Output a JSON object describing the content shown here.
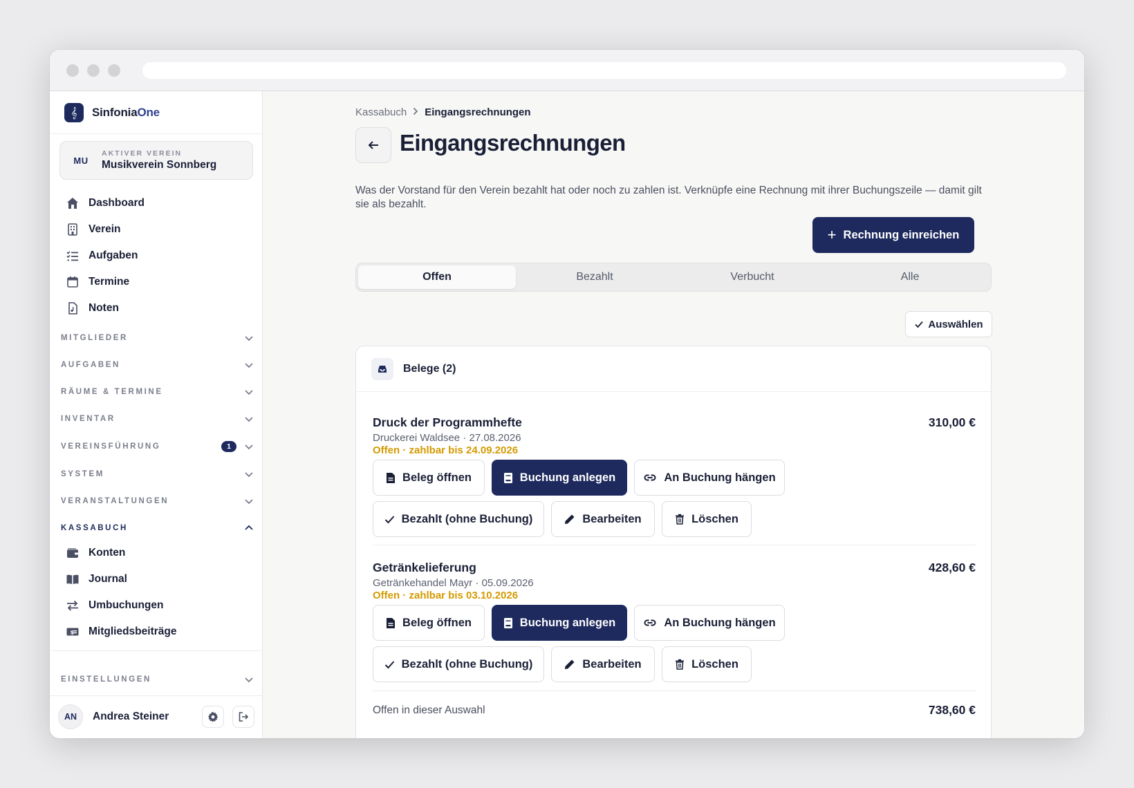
{
  "brand": {
    "name_a": "Sinfonia",
    "name_b": "One",
    "logo_icon": "treble-clef-icon"
  },
  "verein": {
    "code": "MU",
    "label": "AKTIVER VEREIN",
    "name": "Musikverein Sonnberg"
  },
  "nav_main": [
    {
      "label": "Dashboard",
      "icon": "home-icon"
    },
    {
      "label": "Verein",
      "icon": "building-icon"
    },
    {
      "label": "Aufgaben",
      "icon": "checklist-icon"
    },
    {
      "label": "Termine",
      "icon": "calendar-icon"
    },
    {
      "label": "Noten",
      "icon": "sheet-icon"
    }
  ],
  "sections": [
    {
      "label": "MITGLIEDER"
    },
    {
      "label": "AUFGABEN"
    },
    {
      "label": "RÄUME & TERMINE"
    },
    {
      "label": "INVENTAR"
    },
    {
      "label": "VEREINSFÜHRUNG",
      "badge": "1"
    },
    {
      "label": "SYSTEM"
    },
    {
      "label": "VERANSTALTUNGEN"
    },
    {
      "label": "KASSABUCH",
      "expanded": true
    }
  ],
  "kassabuch_items": [
    {
      "label": "Konten",
      "icon": "wallet-icon"
    },
    {
      "label": "Journal",
      "icon": "book-icon"
    },
    {
      "label": "Umbuchungen",
      "icon": "transfer-icon"
    },
    {
      "label": "Mitgliedsbeiträge",
      "icon": "money-icon"
    }
  ],
  "settings_section": {
    "label": "EINSTELLUNGEN"
  },
  "user": {
    "initials": "AN",
    "name": "Andrea Steiner"
  },
  "breadcrumb": {
    "parent": "Kassabuch",
    "current": "Eingangsrechnungen"
  },
  "page": {
    "title": "Eingangsrechnungen",
    "description": "Was der Vorstand für den Verein bezahlt hat oder noch zu zahlen ist. Verknüpfe eine Rechnung mit ihrer Buchungszeile — damit gilt sie als bezahlt.",
    "primary_action": "Rechnung einreichen",
    "select_label": "Auswählen"
  },
  "tabs": [
    {
      "label": "Offen",
      "active": true
    },
    {
      "label": "Bezahlt"
    },
    {
      "label": "Verbucht"
    },
    {
      "label": "Alle"
    }
  ],
  "card": {
    "title": "Belege (2)",
    "items": [
      {
        "title": "Druck der Programmhefte",
        "meta": "Druckerei Waldsee · 27.08.2026",
        "status": "Offen · zahlbar bis 24.09.2026",
        "amount": "310,00 €"
      },
      {
        "title": "Getränkelieferung",
        "meta": "Getränkehandel Mayr · 05.09.2026",
        "status": "Offen · zahlbar bis 03.10.2026",
        "amount": "428,60 €"
      }
    ],
    "actions": {
      "open": "Beleg öffnen",
      "create": "Buchung anlegen",
      "attach": "An Buchung hängen",
      "paid": "Bezahlt (ohne Buchung)",
      "edit": "Bearbeiten",
      "delete": "Löschen"
    },
    "summary_label": "Offen in dieser Auswahl",
    "summary_value": "738,60 €"
  },
  "colors": {
    "accent": "#1e2a5e",
    "status_open": "#d49a00"
  }
}
